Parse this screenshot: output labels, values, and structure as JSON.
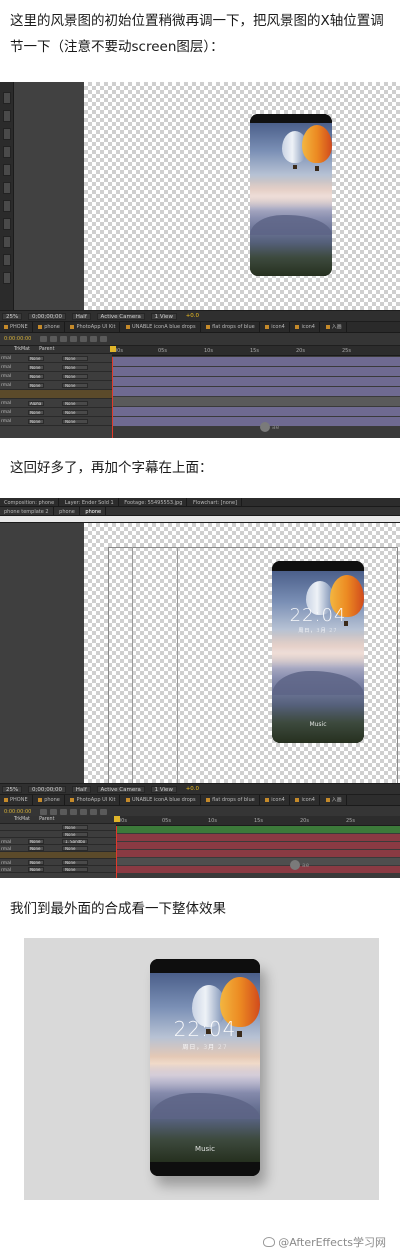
{
  "captions": {
    "first": "这里的风景图的初始位置稍微再调一下，把风景图的X轴位置调节一下（注意不要动screen图层）：",
    "second": "这回好多了，再加个字幕在上面：",
    "third": "我们到最外面的合成看一下整体效果"
  },
  "ae1": {
    "viewer_bar": [
      "25%",
      "0;00;00;00",
      "Half",
      "Active Camera",
      "1 View",
      "+0.0"
    ],
    "tabs": [
      "PHONE",
      "phone",
      "PhotoApp UI Kit",
      "UNABLE iconA blue drops",
      "flat drops of blue",
      "icon4",
      "icon4",
      "入画"
    ],
    "timecode": "0:00:00:00",
    "ruler_ticks": [
      "00s",
      "05s",
      "10s",
      "15s",
      "20s",
      "25s"
    ],
    "layer_header": [
      "TrkMat",
      "Parent"
    ],
    "layer_rows": [
      {
        "name": "rmal",
        "trkmat": "None",
        "parent": "None"
      },
      {
        "name": "rmal",
        "trkmat": "None",
        "parent": "None"
      },
      {
        "name": "rmal",
        "trkmat": "None",
        "parent": "None"
      },
      {
        "name": "rmal",
        "trkmat": "None",
        "parent": "None"
      },
      {
        "name": "",
        "trkmat": "",
        "parent": ""
      },
      {
        "name": "rmal",
        "trkmat": "Alpha",
        "parent": "None"
      },
      {
        "name": "rmal",
        "trkmat": "None",
        "parent": "None"
      },
      {
        "name": "rmal",
        "trkmat": "None",
        "parent": "None"
      }
    ],
    "watermark": "ae"
  },
  "ae2": {
    "panel_tabs": [
      "Composition: phone",
      "Layer: Ender Sold 1",
      "Footage: 55495553.jpg",
      "Flowchart: [none]"
    ],
    "breadcrumb": [
      "phone template 2",
      "phone",
      "phone"
    ],
    "viewer_bar": [
      "25%",
      "0;00;00;00",
      "Half",
      "Active Camera",
      "1 View",
      "+0.0"
    ],
    "tabs": [
      "PHONE",
      "phone",
      "PhotoApp UI Kit",
      "UNABLE iconA blue drops",
      "flat drops of blue",
      "icon4",
      "icon4",
      "入画"
    ],
    "timecode": "0:00:00:00",
    "ruler_ticks": [
      "00s",
      "05s",
      "10s",
      "15s",
      "20s",
      "25s"
    ],
    "layer_header": [
      "TrkMat",
      "Parent"
    ],
    "layer_rows": [
      {
        "name": "",
        "trkmat": "",
        "parent": "None"
      },
      {
        "name": "",
        "trkmat": "",
        "parent": "None"
      },
      {
        "name": "rmal",
        "trkmat": "None",
        "parent": "1. Sandbo"
      },
      {
        "name": "rmal",
        "trkmat": "None",
        "parent": "None"
      },
      {
        "name": "",
        "trkmat": "",
        "parent": ""
      },
      {
        "name": "rmal",
        "trkmat": "None",
        "parent": "None"
      },
      {
        "name": "rmal",
        "trkmat": "None",
        "parent": "None"
      }
    ],
    "phone_time": "22:04",
    "phone_date": "周日，3月 27",
    "phone_music": "Music",
    "watermark": "ae"
  },
  "final": {
    "phone_time": "22:04",
    "phone_date": "周日，3月 27",
    "phone_music": "Music"
  },
  "footer": {
    "weibo_handle": "@AfterEffects学习网"
  },
  "colors": {
    "ae_bg": "#3a3a3a",
    "timeline_purple": "#6f6a91",
    "timeline_red": "#8a3a43",
    "cti_red": "#e03a2a",
    "balloon_orange": "#e8962a",
    "balloon_white": "#e8ecf2"
  }
}
